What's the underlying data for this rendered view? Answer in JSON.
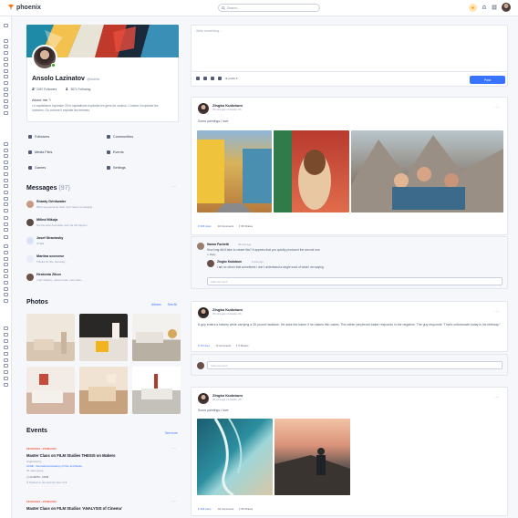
{
  "app": {
    "name": "phoenix"
  },
  "search": {
    "placeholder": "Search..."
  },
  "profile": {
    "name": "Ansolo Lazinatov",
    "handle": "@fadedb",
    "followers": "2287 Followers",
    "following": "3871 Following",
    "about_title": "About me",
    "about_text": "Le capitalisme explosite 25 le capitalisme explosite les gens de couleur. Comme il explosite les hommes. Ou comme il exploite les femmes."
  },
  "quick_links": [
    {
      "label": "Followers"
    },
    {
      "label": "Communities"
    },
    {
      "label": "Media Files"
    },
    {
      "label": "Events"
    },
    {
      "label": "Games"
    },
    {
      "label": "Settings"
    }
  ],
  "messages": {
    "title": "Messages",
    "count": "(97)",
    "items": [
      {
        "name": "Shanty Drinkwater",
        "text": "When we gonna be back, don't leave me hanging"
      },
      {
        "name": "Milind Mikuja",
        "text": "Not the same feel dude, don't let this happen"
      },
      {
        "name": "Josef Stravinsky",
        "text": "I'll Talk"
      },
      {
        "name": "Martina scorcese",
        "text": "Thanks for this, Seriously..."
      },
      {
        "name": "Herdonia Zikon",
        "text": "I can't believe, I knew it was. Lets make..."
      }
    ]
  },
  "photos": {
    "title": "Photos",
    "album_link": "Albums",
    "see_all": "See All",
    "items": [
      "photo-1",
      "photo-2",
      "photo-3",
      "photo-4",
      "photo-5",
      "photo-6"
    ]
  },
  "events": {
    "title": "Events",
    "see_more": "See more",
    "items": [
      {
        "date": "18/06/2023 - 25/06/2023",
        "title": "Master Class on FILM Studies THESIS on Makers",
        "organizer_label": "Organized by",
        "organizer": "ACRE : International Academy of Film and Media",
        "status": "26 users going",
        "time": "12:00PM - 10PM",
        "place": "Twisted on the Ground, New York"
      },
      {
        "date": "18/06/2023 - 25/06/2023",
        "title": "Master Class on FILM Studios 'ANALYSIS of Cinema'"
      }
    ]
  },
  "composer": {
    "placeholder": "Write something...",
    "audience": "public",
    "post_label": "Post"
  },
  "posts": [
    {
      "author": "Zingko Kudobum",
      "meta": "35 mins ago • Consulto, UK",
      "text": "Some paintings I love",
      "likes": "345 Likes",
      "comments": "40 Comments",
      "shares": "80 Shares",
      "comments_list": [
        {
          "name": "Hamar Fachetti",
          "time": "35 mins ago",
          "text": "How long did it take to create this? It appears that you quickly produced the second one.",
          "reply": "Reply"
        },
        {
          "name": "Zingko Kudobum",
          "time": "5 mins ago",
          "text": "I am so clever that sometimes I don't understand a single word of what I am saying."
        }
      ],
      "add_comment": "Add comment"
    },
    {
      "author": "Zingko Kudobum",
      "meta": "35 mins ago • Consulto, UK",
      "text": "A guy enters a bakery while carrying a 25 pound haddock. He asks the baker if he makes fish cakes. The rather perplexed baker responds in the negative. The guy responds \"That's unfortunate today is his birthday.\"",
      "likes": "15 Likes",
      "comments": "8 Comments",
      "shares": "5 Shares",
      "add_comment": "Add comment"
    },
    {
      "author": "Zingko Kudobum",
      "meta": "35 mins ago • Consulto, UK",
      "text": "Some paintings I love",
      "likes": "345 Likes",
      "comments": "40 Comments",
      "shares": "80 Shares"
    }
  ],
  "colors": {
    "accent": "#3874ff",
    "brand": "#f97316",
    "online": "#25b003",
    "event_date": "#ec1f00"
  }
}
